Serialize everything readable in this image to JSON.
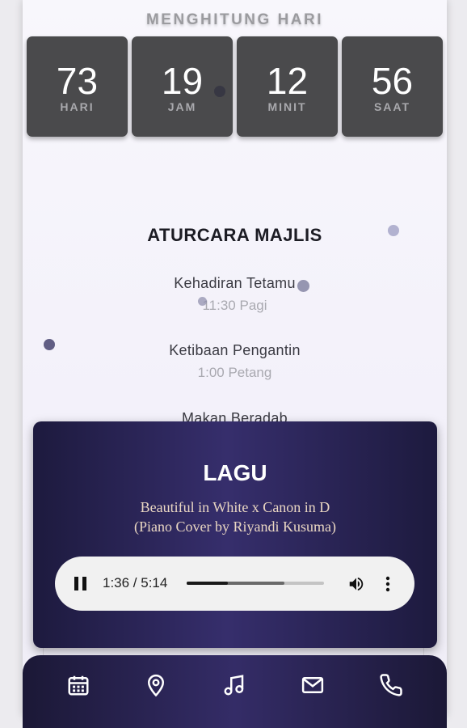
{
  "countdown": {
    "title": "MENGHITUNG HARI",
    "units": [
      {
        "value": "73",
        "label": "HARI"
      },
      {
        "value": "19",
        "label": "JAM"
      },
      {
        "value": "12",
        "label": "MINIT"
      },
      {
        "value": "56",
        "label": "SAAT"
      }
    ]
  },
  "schedule": {
    "heading": "ATURCARA MAJLIS",
    "events": [
      {
        "name": "Kehadiran Tetamu",
        "time": "11:30 Pagi"
      },
      {
        "name": "Ketibaan Pengantin",
        "time": "1:00 Petang"
      },
      {
        "name": "Makan Beradab",
        "time": ""
      }
    ]
  },
  "player": {
    "title": "LAGU",
    "song_line1": "Beautiful in White x Canon in D",
    "song_line2": "(Piano Cover by Riyandi Kusuma)",
    "time_display": "1:36 / 5:14",
    "progress": 0.3,
    "buffered": 0.71,
    "controls": [
      "pause-icon",
      "volume-icon",
      "more-vert-icon"
    ]
  },
  "bottom_nav": {
    "items": [
      "calendar-icon",
      "location-pin-icon",
      "music-icon",
      "mail-icon",
      "phone-icon"
    ]
  },
  "colors": {
    "countdown_box": "#4a4a4c",
    "player_bg": "#2b255a",
    "song_text": "#e9d6c2",
    "nav_bg": "#252050"
  }
}
